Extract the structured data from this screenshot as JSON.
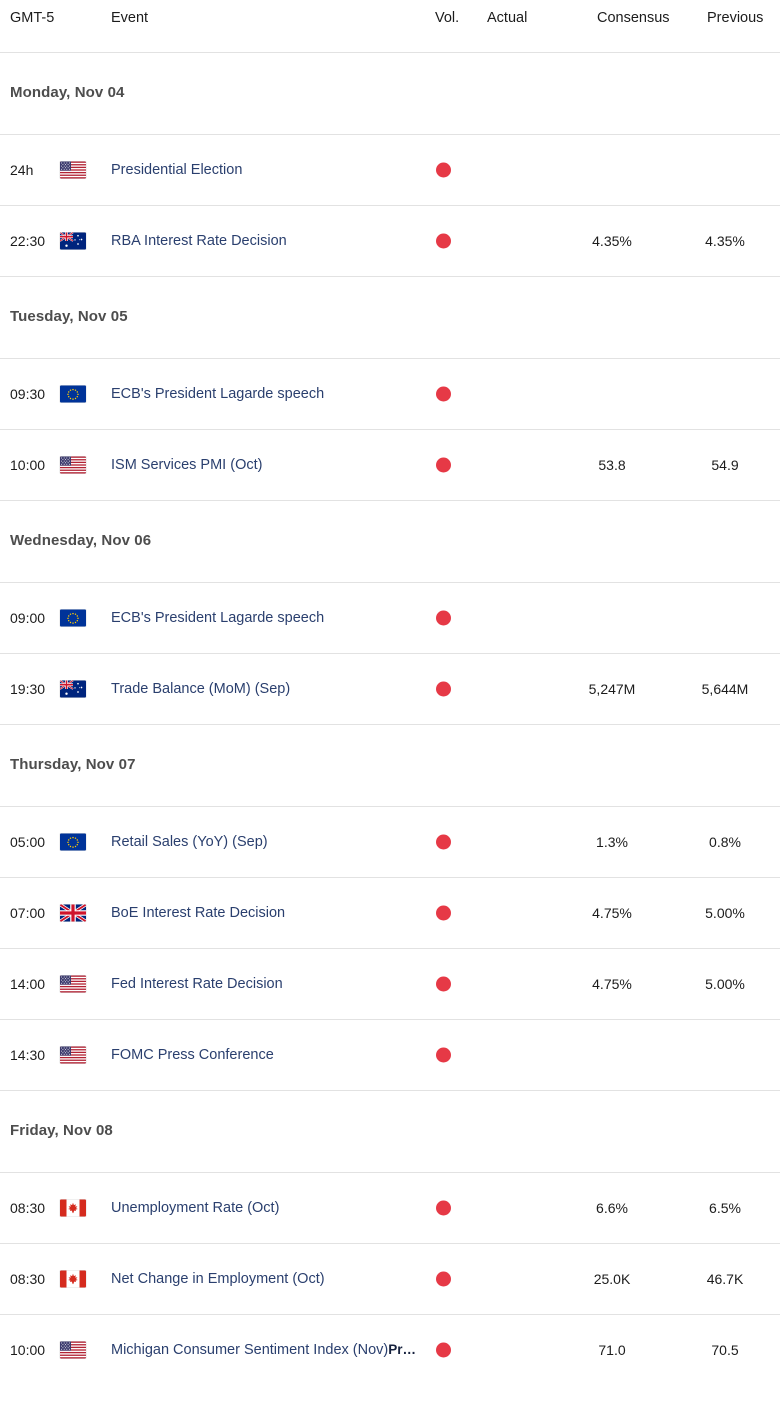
{
  "header": {
    "timezone": "GMT-5",
    "event": "Event",
    "volatility": "Vol.",
    "actual": "Actual",
    "consensus": "Consensus",
    "previous": "Previous"
  },
  "colors": {
    "volatility_high": "#e63946",
    "event_link": "#2a3f6e",
    "day_label": "#4d4d4d",
    "row_divider": "#e2e2e2",
    "background": "#ffffff"
  },
  "days": [
    {
      "label": "Monday, Nov 04",
      "events": [
        {
          "time": "24h",
          "flag": "us-flag-icon",
          "title": "Presidential Election",
          "title_suffix": "",
          "volatility": "high",
          "actual": "",
          "consensus": "",
          "previous": ""
        },
        {
          "time": "22:30",
          "flag": "au-flag-icon",
          "title": "RBA Interest Rate Decision",
          "title_suffix": "",
          "volatility": "high",
          "actual": "",
          "consensus": "4.35%",
          "previous": "4.35%"
        }
      ]
    },
    {
      "label": "Tuesday, Nov 05",
      "events": [
        {
          "time": "09:30",
          "flag": "eu-flag-icon",
          "title": "ECB's President Lagarde speech",
          "title_suffix": "",
          "volatility": "high",
          "actual": "",
          "consensus": "",
          "previous": ""
        },
        {
          "time": "10:00",
          "flag": "us-flag-icon",
          "title": "ISM Services PMI (Oct)",
          "title_suffix": "",
          "volatility": "high",
          "actual": "",
          "consensus": "53.8",
          "previous": "54.9"
        }
      ]
    },
    {
      "label": "Wednesday, Nov 06",
      "events": [
        {
          "time": "09:00",
          "flag": "eu-flag-icon",
          "title": "ECB's President Lagarde speech",
          "title_suffix": "",
          "volatility": "high",
          "actual": "",
          "consensus": "",
          "previous": ""
        },
        {
          "time": "19:30",
          "flag": "au-flag-icon",
          "title": "Trade Balance (MoM) (Sep)",
          "title_suffix": "",
          "volatility": "high",
          "actual": "",
          "consensus": "5,247M",
          "previous": "5,644M"
        }
      ]
    },
    {
      "label": "Thursday, Nov 07",
      "events": [
        {
          "time": "05:00",
          "flag": "eu-flag-icon",
          "title": "Retail Sales (YoY) (Sep)",
          "title_suffix": "",
          "volatility": "high",
          "actual": "",
          "consensus": "1.3%",
          "previous": "0.8%"
        },
        {
          "time": "07:00",
          "flag": "gb-flag-icon",
          "title": "BoE Interest Rate Decision",
          "title_suffix": "",
          "volatility": "high",
          "actual": "",
          "consensus": "4.75%",
          "previous": "5.00%"
        },
        {
          "time": "14:00",
          "flag": "us-flag-icon",
          "title": "Fed Interest Rate Decision",
          "title_suffix": "",
          "volatility": "high",
          "actual": "",
          "consensus": "4.75%",
          "previous": "5.00%"
        },
        {
          "time": "14:30",
          "flag": "us-flag-icon",
          "title": "FOMC Press Conference",
          "title_suffix": "",
          "volatility": "high",
          "actual": "",
          "consensus": "",
          "previous": ""
        }
      ]
    },
    {
      "label": "Friday, Nov 08",
      "events": [
        {
          "time": "08:30",
          "flag": "ca-flag-icon",
          "title": "Unemployment Rate (Oct)",
          "title_suffix": "",
          "volatility": "high",
          "actual": "",
          "consensus": "6.6%",
          "previous": "6.5%"
        },
        {
          "time": "08:30",
          "flag": "ca-flag-icon",
          "title": "Net Change in Employment (Oct)",
          "title_suffix": "",
          "volatility": "high",
          "actual": "",
          "consensus": "25.0K",
          "previous": "46.7K"
        },
        {
          "time": "10:00",
          "flag": "us-flag-icon",
          "title": "Michigan Consumer Sentiment Index (Nov)",
          "title_suffix": "Pr…",
          "volatility": "high",
          "actual": "",
          "consensus": "71.0",
          "previous": "70.5"
        }
      ]
    }
  ]
}
